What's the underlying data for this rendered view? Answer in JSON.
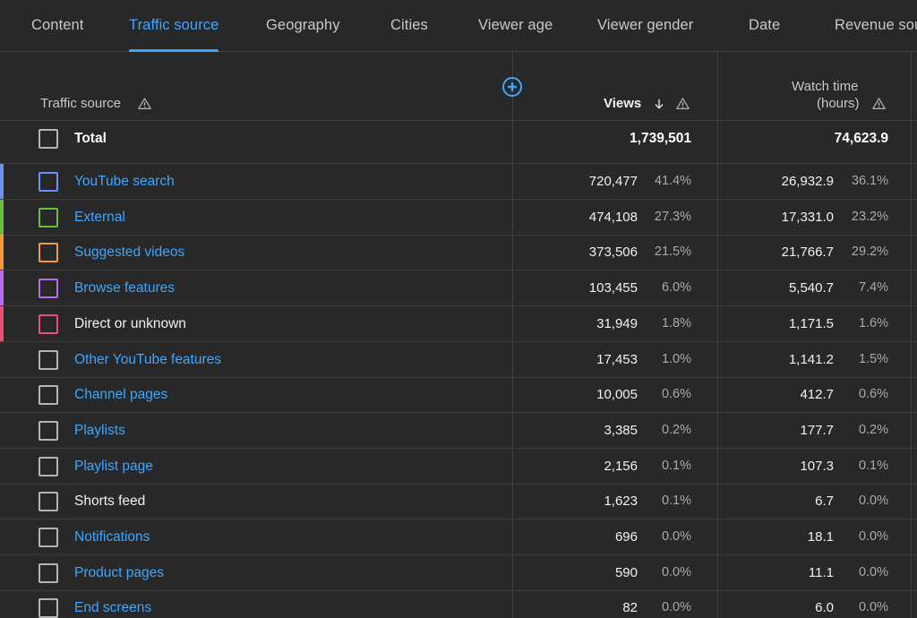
{
  "tabs": [
    {
      "label": "Content",
      "active": false
    },
    {
      "label": "Traffic source",
      "active": true
    },
    {
      "label": "Geography",
      "active": false
    },
    {
      "label": "Cities",
      "active": false
    },
    {
      "label": "Viewer age",
      "active": false
    },
    {
      "label": "Viewer gender",
      "active": false
    },
    {
      "label": "Date",
      "active": false
    },
    {
      "label": "Revenue sou",
      "active": false
    }
  ],
  "header": {
    "traffic_source": "Traffic source",
    "views": "Views",
    "watch_time_line1": "Watch time",
    "watch_time_line2": "(hours)",
    "add_icon": "add-circle-icon",
    "warning_icon": "warning-triangle-icon",
    "sort_icon": "arrow-down-icon"
  },
  "total": {
    "label": "Total",
    "views": "1,739,501",
    "watch_time": "74,623.9"
  },
  "rows": [
    {
      "label": "YouTube search",
      "views": "720,477",
      "views_pct": "41.4%",
      "watch": "26,932.9",
      "watch_pct": "36.1%",
      "color": "#6f8ff5",
      "link": true
    },
    {
      "label": "External",
      "views": "474,108",
      "views_pct": "27.3%",
      "watch": "17,331.0",
      "watch_pct": "23.2%",
      "color": "#6dbd3c",
      "link": true
    },
    {
      "label": "Suggested videos",
      "views": "373,506",
      "views_pct": "21.5%",
      "watch": "21,766.7",
      "watch_pct": "29.2%",
      "color": "#f59a3a",
      "link": true
    },
    {
      "label": "Browse features",
      "views": "103,455",
      "views_pct": "6.0%",
      "watch": "5,540.7",
      "watch_pct": "7.4%",
      "color": "#b36ef0",
      "link": true
    },
    {
      "label": "Direct or unknown",
      "views": "31,949",
      "views_pct": "1.8%",
      "watch": "1,171.5",
      "watch_pct": "1.6%",
      "color": "#e8507a",
      "link": false
    },
    {
      "label": "Other YouTube features",
      "views": "17,453",
      "views_pct": "1.0%",
      "watch": "1,141.2",
      "watch_pct": "1.5%",
      "color": "",
      "link": true
    },
    {
      "label": "Channel pages",
      "views": "10,005",
      "views_pct": "0.6%",
      "watch": "412.7",
      "watch_pct": "0.6%",
      "color": "",
      "link": true
    },
    {
      "label": "Playlists",
      "views": "3,385",
      "views_pct": "0.2%",
      "watch": "177.7",
      "watch_pct": "0.2%",
      "color": "",
      "link": true
    },
    {
      "label": "Playlist page",
      "views": "2,156",
      "views_pct": "0.1%",
      "watch": "107.3",
      "watch_pct": "0.1%",
      "color": "",
      "link": true
    },
    {
      "label": "Shorts feed",
      "views": "1,623",
      "views_pct": "0.1%",
      "watch": "6.7",
      "watch_pct": "0.0%",
      "color": "",
      "link": false
    },
    {
      "label": "Notifications",
      "views": "696",
      "views_pct": "0.0%",
      "watch": "18.1",
      "watch_pct": "0.0%",
      "color": "",
      "link": true
    },
    {
      "label": "Product pages",
      "views": "590",
      "views_pct": "0.0%",
      "watch": "11.1",
      "watch_pct": "0.0%",
      "color": "",
      "link": true
    },
    {
      "label": "End screens",
      "views": "82",
      "views_pct": "0.0%",
      "watch": "6.0",
      "watch_pct": "0.0%",
      "color": "",
      "link": true
    }
  ]
}
